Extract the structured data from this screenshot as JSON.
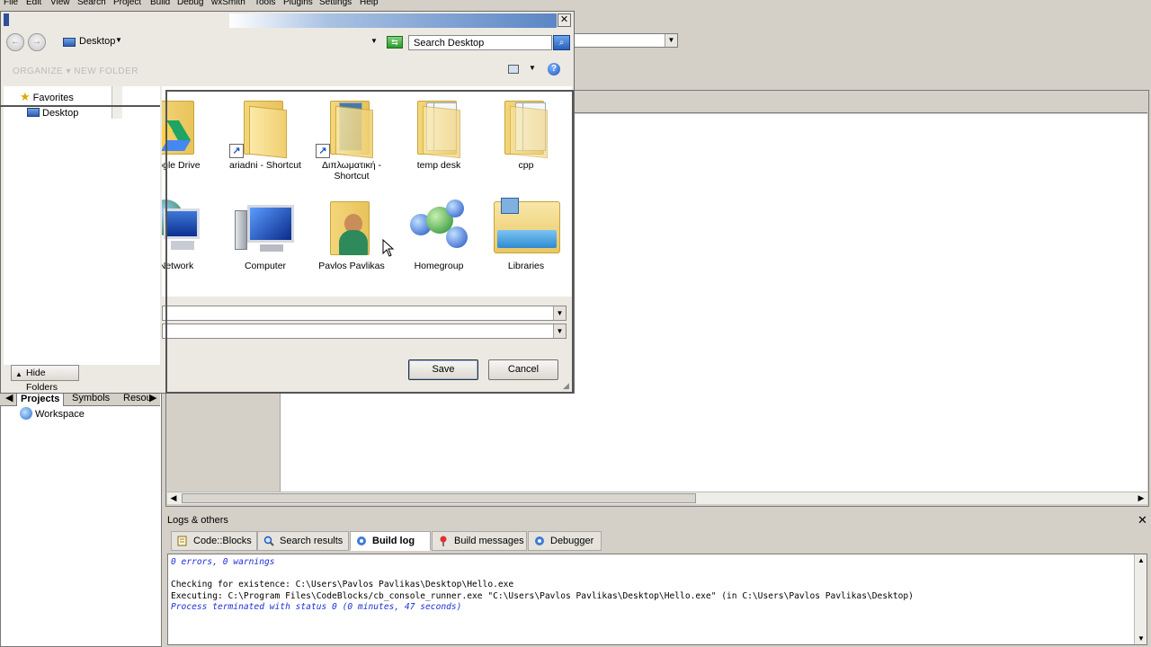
{
  "menubar": {
    "items": [
      "File",
      "Edit",
      "View",
      "Search",
      "Project",
      "Build",
      "Debug",
      "wxSmith",
      "Tools",
      "Plugins",
      "Settings",
      "Help"
    ]
  },
  "save_dialog": {
    "close_glyph": "✕",
    "address": "Desktop",
    "search_placeholder": "Search Desktop",
    "toolbar_ghost": "ORGANIZE ▾   NEW FOLDER",
    "nav": {
      "favorites": "Favorites",
      "desktop": "Desktop",
      "hide_folders": "Hide Folders"
    },
    "files": [
      {
        "label": "oogle Drive",
        "icon": "google-drive-icon"
      },
      {
        "label": "ariadni - Shortcut",
        "icon": "folder-shortcut-icon"
      },
      {
        "label": "Διπλωματική - Shortcut",
        "icon": "folder-shortcut-icon"
      },
      {
        "label": "temp desk",
        "icon": "folder-icon"
      },
      {
        "label": "cpp",
        "icon": "folder-icon"
      },
      {
        "label": "Network",
        "icon": "network-icon"
      },
      {
        "label": "Computer",
        "icon": "computer-icon"
      },
      {
        "label": "Pavlos Pavlikas",
        "icon": "user-folder-icon"
      },
      {
        "label": "Homegroup",
        "icon": "homegroup-icon"
      },
      {
        "label": "Libraries",
        "icon": "libraries-icon"
      }
    ],
    "file_name_value": "",
    "save_as_type_value": "",
    "save_label": "Save",
    "cancel_label": "Cancel"
  },
  "management": {
    "tabs": [
      "Projects",
      "Symbols",
      "Resou"
    ],
    "workspace": "Workspace"
  },
  "logs": {
    "title": "Logs & others",
    "tabs": [
      {
        "label": "Code::Blocks",
        "icon": "note-icon"
      },
      {
        "label": "Search results",
        "icon": "search-icon"
      },
      {
        "label": "Build log",
        "icon": "gear-icon"
      },
      {
        "label": "Build messages",
        "icon": "pin-icon"
      },
      {
        "label": "Debugger",
        "icon": "gear-icon"
      }
    ],
    "active_tab": "Build log",
    "lines": [
      {
        "text": "0 errors, 0 warnings",
        "style": "blue"
      },
      {
        "text": "",
        "style": "normal"
      },
      {
        "text": "Checking for existence: C:\\Users\\Pavlos Pavlikas\\Desktop\\Hello.exe",
        "style": "normal"
      },
      {
        "text": "Executing: C:\\Program Files\\CodeBlocks/cb_console_runner.exe \"C:\\Users\\Pavlos Pavlikas\\Desktop\\Hello.exe\" (in C:\\Users\\Pavlos Pavlikas\\Desktop)",
        "style": "normal"
      },
      {
        "text": "Process terminated with status 0 (0 minutes, 47 seconds)",
        "style": "blue"
      }
    ]
  },
  "colors": {
    "chrome": "#d4d0c8",
    "log_blue": "#1e2fd8",
    "title_gradient_end": "#5b86c4"
  }
}
